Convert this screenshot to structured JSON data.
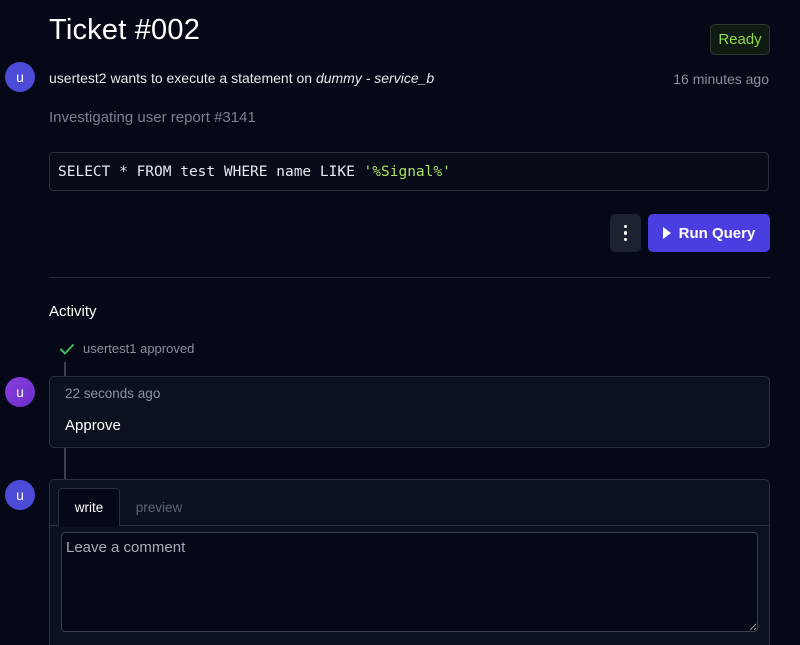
{
  "ticket": {
    "title": "Ticket #002",
    "status": "Ready",
    "status_color": "#8fd94b"
  },
  "request": {
    "avatar_initial": "u",
    "user": "usertest2",
    "action_text": " wants to execute a statement on ",
    "target": "dummy - service_b",
    "timestamp": "16 minutes ago",
    "description": "Investigating user report #3141"
  },
  "query": {
    "prefix": "SELECT * FROM test WHERE name LIKE ",
    "string_literal": "'%Signal%'"
  },
  "toolbar": {
    "more_icon": "kebab-menu-icon",
    "run_label": "Run Query",
    "run_icon": "play-icon",
    "accent_color": "#4a3ee0"
  },
  "activity": {
    "heading": "Activity",
    "approval_text": "usertest1 approved",
    "approval_icon": "check-icon",
    "comment": {
      "avatar_initial": "u",
      "timestamp": "22 seconds ago",
      "body": "Approve"
    }
  },
  "editor": {
    "avatar_initial": "u",
    "tabs": [
      {
        "label": "write",
        "active": true
      },
      {
        "label": "preview",
        "active": false
      }
    ],
    "placeholder": "Leave a comment",
    "value": ""
  }
}
